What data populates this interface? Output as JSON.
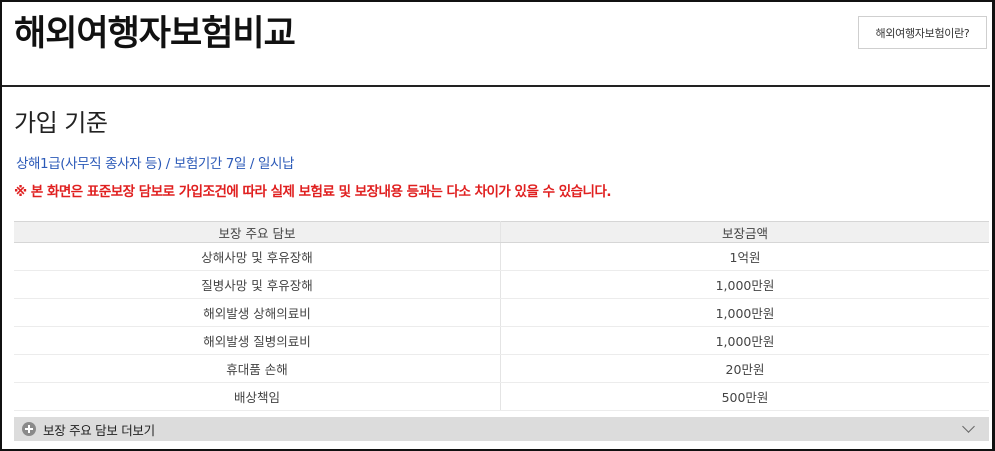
{
  "header": {
    "title": "해외여행자보험비교",
    "info_button_label": "해외여행자보험이란?"
  },
  "section": {
    "title": "가입 기준",
    "criteria": "상해1급(사무직 종사자 등) / 보험기간 7일 / 일시납",
    "notice": "※ 본 화면은 표준보장 담보로 가입조건에 따라 실제 보험료 및 보장내용 등과는 다소 차이가 있을 수 있습니다."
  },
  "table": {
    "columns": [
      "보장 주요 담보",
      "보장금액"
    ],
    "rows": [
      [
        "상해사망 및 후유장해",
        "1억원"
      ],
      [
        "질병사망 및 후유장해",
        "1,000만원"
      ],
      [
        "해외발생 상해의료비",
        "1,000만원"
      ],
      [
        "해외발생 질병의료비",
        "1,000만원"
      ],
      [
        "휴대품 손해",
        "20만원"
      ],
      [
        "배상책임",
        "500만원"
      ]
    ]
  },
  "more": {
    "label": "보장 주요 담보 더보기",
    "icon": "plus-circle-icon",
    "toggle_icon": "chevron-down-icon"
  }
}
